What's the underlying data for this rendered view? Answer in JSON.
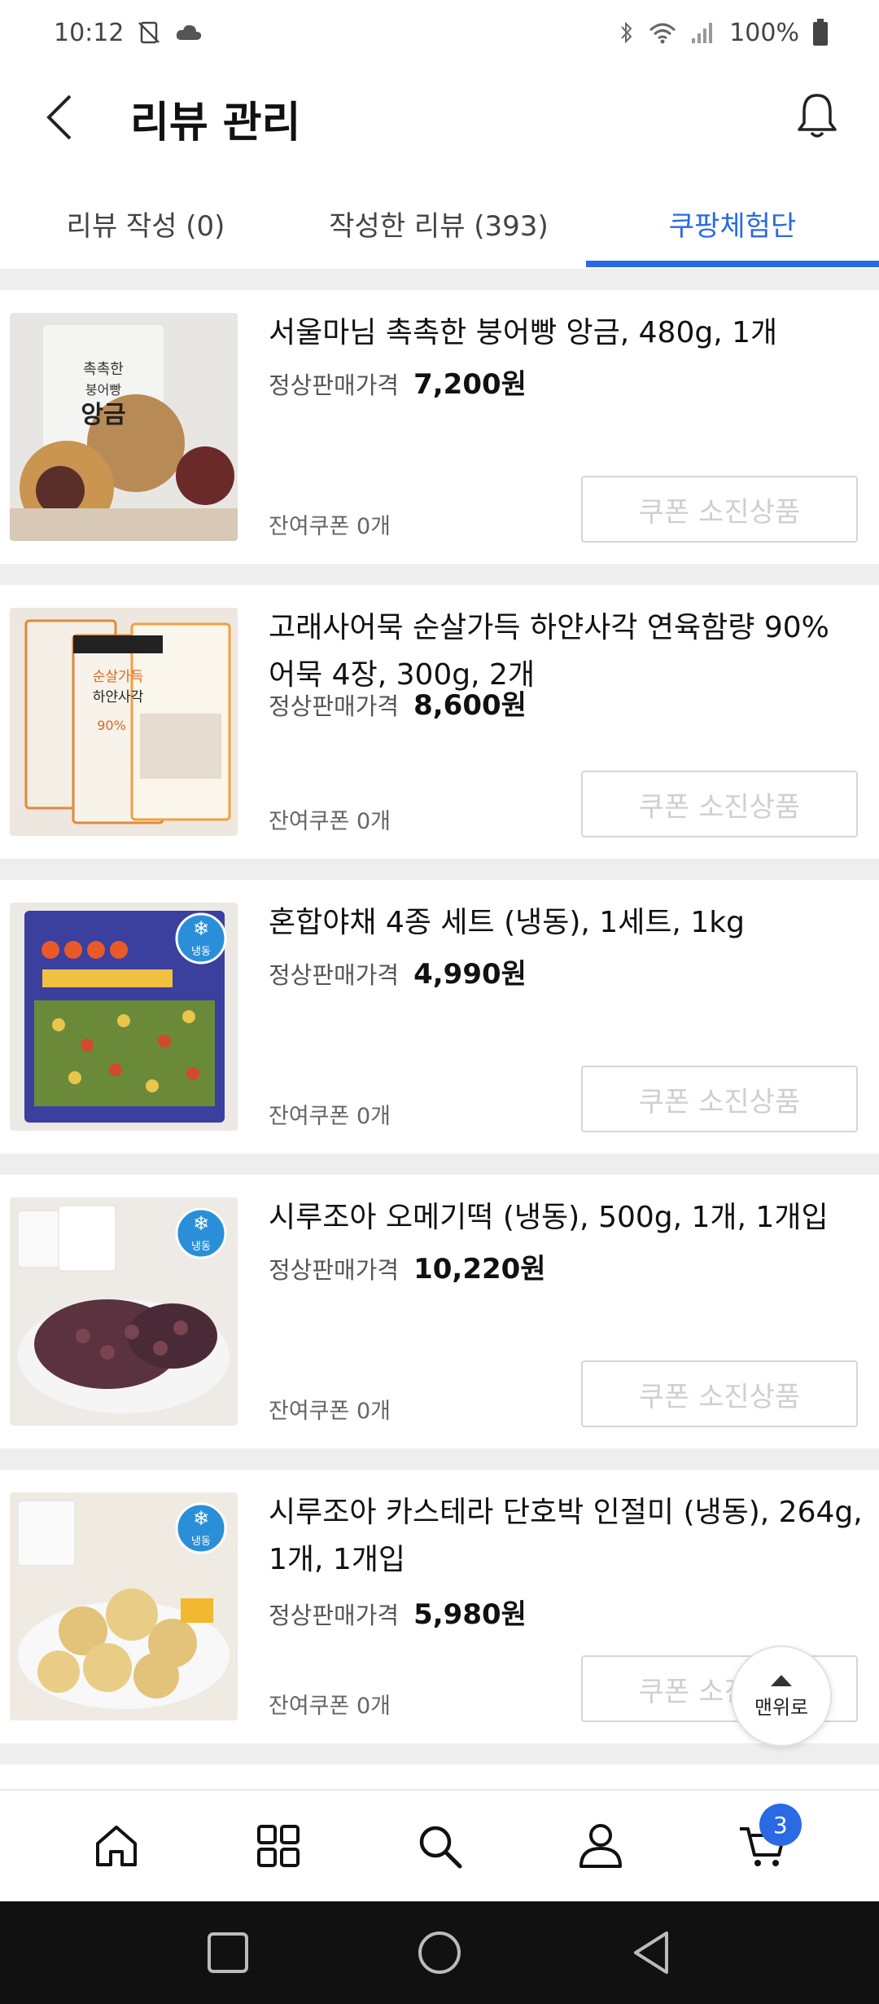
{
  "status_bar": {
    "time": "10:12",
    "battery": "100%"
  },
  "header": {
    "title": "리뷰 관리"
  },
  "tabs": [
    {
      "label": "리뷰 작성 (0)"
    },
    {
      "label": "작성한 리뷰 (393)"
    },
    {
      "label": "쿠팡체험단"
    }
  ],
  "active_tab": 2,
  "colors": {
    "accent": "#2a6ae3",
    "separator": "#eeeeee",
    "disabled_text": "#cfcfcf"
  },
  "products": [
    {
      "name": "서울마님 촉촉한 붕어빵 앙금, 480g, 1개",
      "price_label": "정상판매가격",
      "price": "7,200원",
      "coupon_left": "잔여쿠폰 0개",
      "coupon_button": "쿠폰 소진상품",
      "thumb_text": [
        "촉촉한",
        "붕어빵",
        "앙금"
      ]
    },
    {
      "name": "고래사어묵 순살가득 하얀사각 연육함량 90% 어묵 4장, 300g, 2개",
      "price_label": "정상판매가격",
      "price": "8,600원",
      "coupon_left": "잔여쿠폰 0개",
      "coupon_button": "쿠폰 소진상품",
      "thumb_text": [
        "순살가득",
        "하얀사각",
        "90%"
      ]
    },
    {
      "name": "혼합야채 4종 세트 (냉동), 1세트, 1kg",
      "price_label": "정상판매가격",
      "price": "4,990원",
      "coupon_left": "잔여쿠폰 0개",
      "coupon_button": "쿠폰 소진상품",
      "thumb_text": [
        "냉동"
      ]
    },
    {
      "name": "시루조아 오메기떡 (냉동), 500g, 1개, 1개입",
      "price_label": "정상판매가격",
      "price": "10,220원",
      "coupon_left": "잔여쿠폰 0개",
      "coupon_button": "쿠폰 소진상품",
      "thumb_text": [
        "냉동"
      ]
    },
    {
      "name": "시루조아 카스테라 단호박 인절미 (냉동), 264g, 1개, 1개입",
      "price_label": "정상판매가격",
      "price": "5,980원",
      "coupon_left": "잔여쿠폰 0개",
      "coupon_button": "쿠폰 소진상품",
      "thumb_text": [
        "냉동"
      ]
    }
  ],
  "top_button": {
    "label": "맨위로"
  },
  "bottom_nav": {
    "items": [
      "home-icon",
      "category-icon",
      "search-icon",
      "profile-icon",
      "cart-icon"
    ],
    "cart_count": "3"
  }
}
